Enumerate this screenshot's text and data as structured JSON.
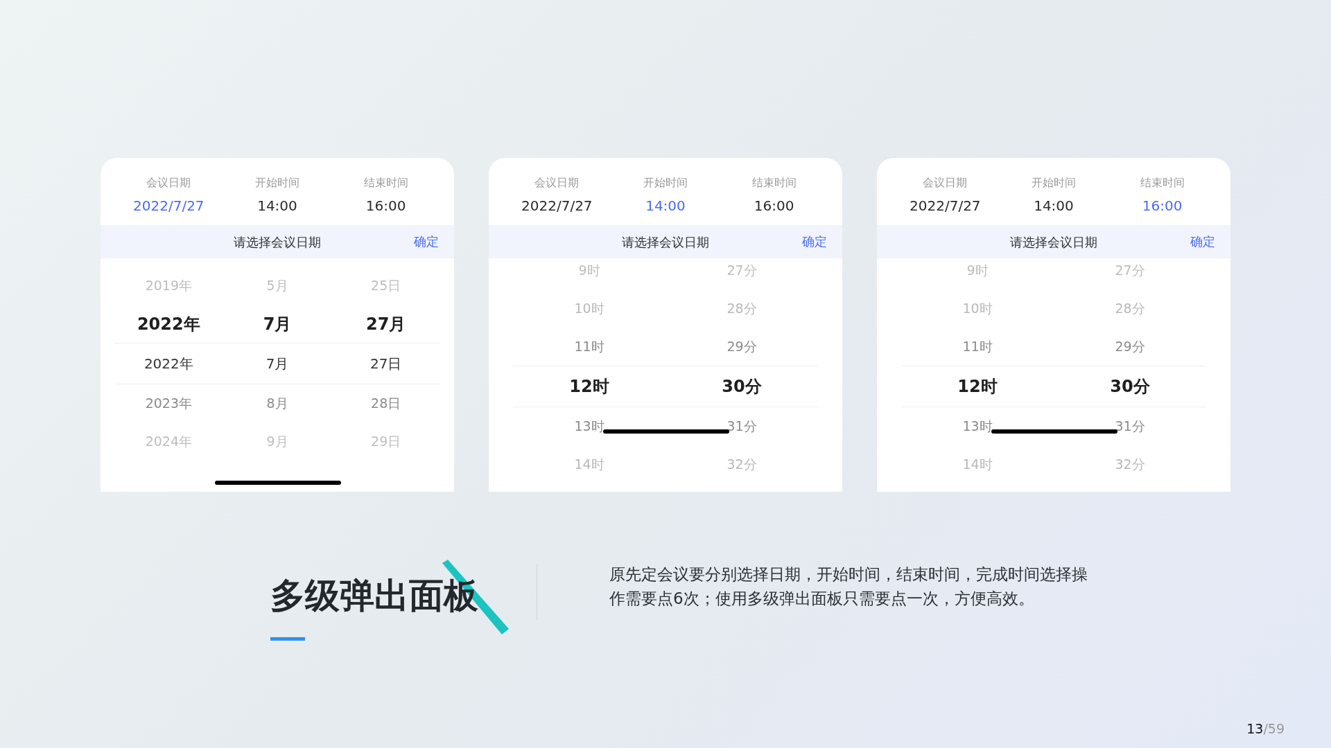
{
  "cards": [
    {
      "fields": [
        {
          "label": "会议日期",
          "value": "2022/7/27",
          "selected": true
        },
        {
          "label": "开始时间",
          "value": "14:00",
          "selected": false
        },
        {
          "label": "结束时间",
          "value": "16:00",
          "selected": false
        }
      ],
      "sheet_title": "请选择会议日期",
      "confirm": "确定",
      "rows": [
        {
          "kind": "faint",
          "selected": false,
          "cells": [
            "2019年",
            "5月",
            "25日"
          ]
        },
        {
          "kind": "bold",
          "selected": false,
          "cells": [
            "2022年",
            "7月",
            "27月"
          ]
        },
        {
          "kind": "dark",
          "selected": true,
          "cells": [
            "2022年",
            "7月",
            "27日"
          ]
        },
        {
          "kind": "gray",
          "selected": false,
          "cells": [
            "2023年",
            "8月",
            "28日"
          ]
        },
        {
          "kind": "faint",
          "selected": false,
          "cells": [
            "2024年",
            "9月",
            "29日"
          ]
        }
      ]
    },
    {
      "fields": [
        {
          "label": "会议日期",
          "value": "2022/7/27",
          "selected": false
        },
        {
          "label": "开始时间",
          "value": "14:00",
          "selected": true
        },
        {
          "label": "结束时间",
          "value": "16:00",
          "selected": false
        }
      ],
      "sheet_title": "请选择会议日期",
      "confirm": "确定",
      "rows": [
        {
          "kind": "faint",
          "selected": false,
          "cells": [
            "9时",
            "27分"
          ]
        },
        {
          "kind": "light",
          "selected": false,
          "cells": [
            "10时",
            "28分"
          ]
        },
        {
          "kind": "gray",
          "selected": false,
          "cells": [
            "11时",
            "29分"
          ]
        },
        {
          "kind": "bold",
          "selected": true,
          "cells": [
            "12时",
            "30分"
          ]
        },
        {
          "kind": "gray",
          "selected": false,
          "cells": [
            "13时",
            "31分"
          ]
        },
        {
          "kind": "light",
          "selected": false,
          "cells": [
            "14时",
            "32分"
          ]
        }
      ]
    },
    {
      "fields": [
        {
          "label": "会议日期",
          "value": "2022/7/27",
          "selected": false
        },
        {
          "label": "开始时间",
          "value": "14:00",
          "selected": false
        },
        {
          "label": "结束时间",
          "value": "16:00",
          "selected": true
        }
      ],
      "sheet_title": "请选择会议日期",
      "confirm": "确定",
      "rows": [
        {
          "kind": "faint",
          "selected": false,
          "cells": [
            "9时",
            "27分"
          ]
        },
        {
          "kind": "light",
          "selected": false,
          "cells": [
            "10时",
            "28分"
          ]
        },
        {
          "kind": "gray",
          "selected": false,
          "cells": [
            "11时",
            "29分"
          ]
        },
        {
          "kind": "bold",
          "selected": true,
          "cells": [
            "12时",
            "30分"
          ]
        },
        {
          "kind": "gray",
          "selected": false,
          "cells": [
            "13时",
            "31分"
          ]
        },
        {
          "kind": "light",
          "selected": false,
          "cells": [
            "14时",
            "32分"
          ]
        }
      ]
    }
  ],
  "title": "多级弹出面板",
  "description": "原先定会议要分别选择日期，开始时间，结束时间，完成时间选择操作需要点6次；使用多级弹出面板只需要点一次，方便高效。",
  "page_number": {
    "current": "13",
    "total": "/59"
  }
}
